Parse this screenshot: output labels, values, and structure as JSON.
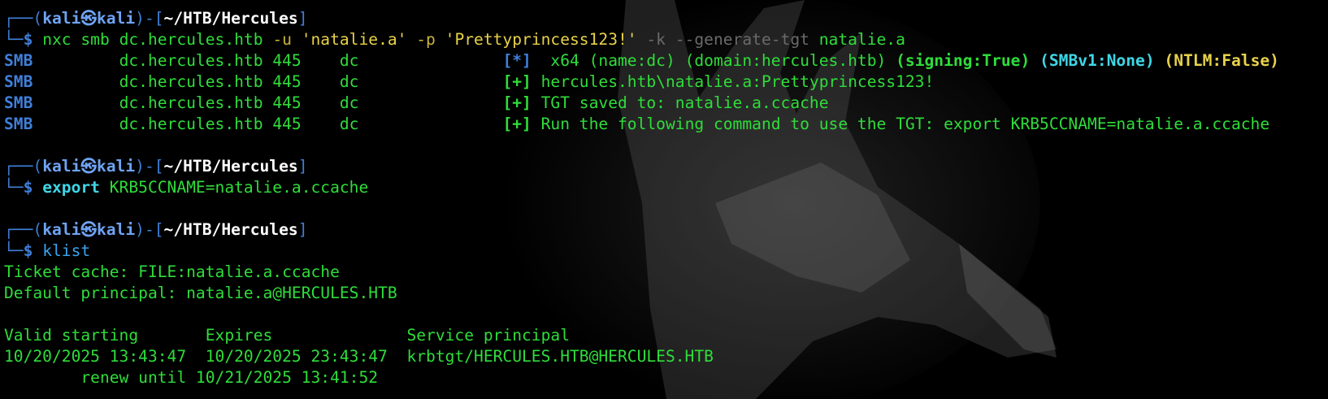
{
  "prompt": {
    "frame_top": "┌──(",
    "user": "kali",
    "host_sep": "㉿",
    "host": "kali",
    "mid": ")-[",
    "cwd": "~/HTB/Hercules",
    "close": "]",
    "frame_bottom": "└─",
    "dollar": "$ "
  },
  "cmd1": {
    "program": "nxc",
    "proto": "smb",
    "target": "dc.hercules.htb",
    "u_flag": "-u",
    "user": "'natalie.a'",
    "p_flag": "-p",
    "pass": "'Prettyprincess123!'",
    "k_flag": "-k",
    "gen_flag": "--generate-tgt",
    "out": "natalie.a"
  },
  "smb_lines": [
    {
      "proto": "SMB",
      "host": "dc.hercules.htb",
      "port": "445",
      "name": "dc",
      "tag": "[*]"
    },
    {
      "proto": "SMB",
      "host": "dc.hercules.htb",
      "port": "445",
      "name": "dc",
      "tag": "[+]",
      "msg": "hercules.htb\\natalie.a:Prettyprincess123!"
    },
    {
      "proto": "SMB",
      "host": "dc.hercules.htb",
      "port": "445",
      "name": "dc",
      "tag": "[+]",
      "msg": "TGT saved to: natalie.a.ccache"
    },
    {
      "proto": "SMB",
      "host": "dc.hercules.htb",
      "port": "445",
      "name": "dc",
      "tag": "[+]",
      "msg": "Run the following command to use the TGT: export KRB5CCNAME=natalie.a.ccache"
    }
  ],
  "smb_info": {
    "arch": "x64",
    "name": "(name:dc)",
    "domain": "(domain:hercules.htb)",
    "signing": "(signing:True)",
    "smbv1": "(SMBv1:None)",
    "ntlm": "(NTLM:False)"
  },
  "cmd2": {
    "keyword": "export",
    "assign": "KRB5CCNAME=natalie.a.ccache"
  },
  "cmd3": {
    "program": "klist"
  },
  "klist": {
    "cache": "Ticket cache: FILE:natalie.a.ccache",
    "principal": "Default principal: natalie.a@HERCULES.HTB",
    "header": "Valid starting       Expires              Service principal",
    "row": "10/20/2025 13:43:47  10/20/2025 23:43:47  krbtgt/HERCULES.HTB@HERCULES.HTB",
    "renew": "        renew until 10/21/2025 13:41:52"
  },
  "colors": {
    "background": "#000000",
    "green": "#2fdd3a",
    "blue": "#3f7fd9",
    "cyan": "#3fd6e6",
    "yellow": "#e8d24a"
  }
}
